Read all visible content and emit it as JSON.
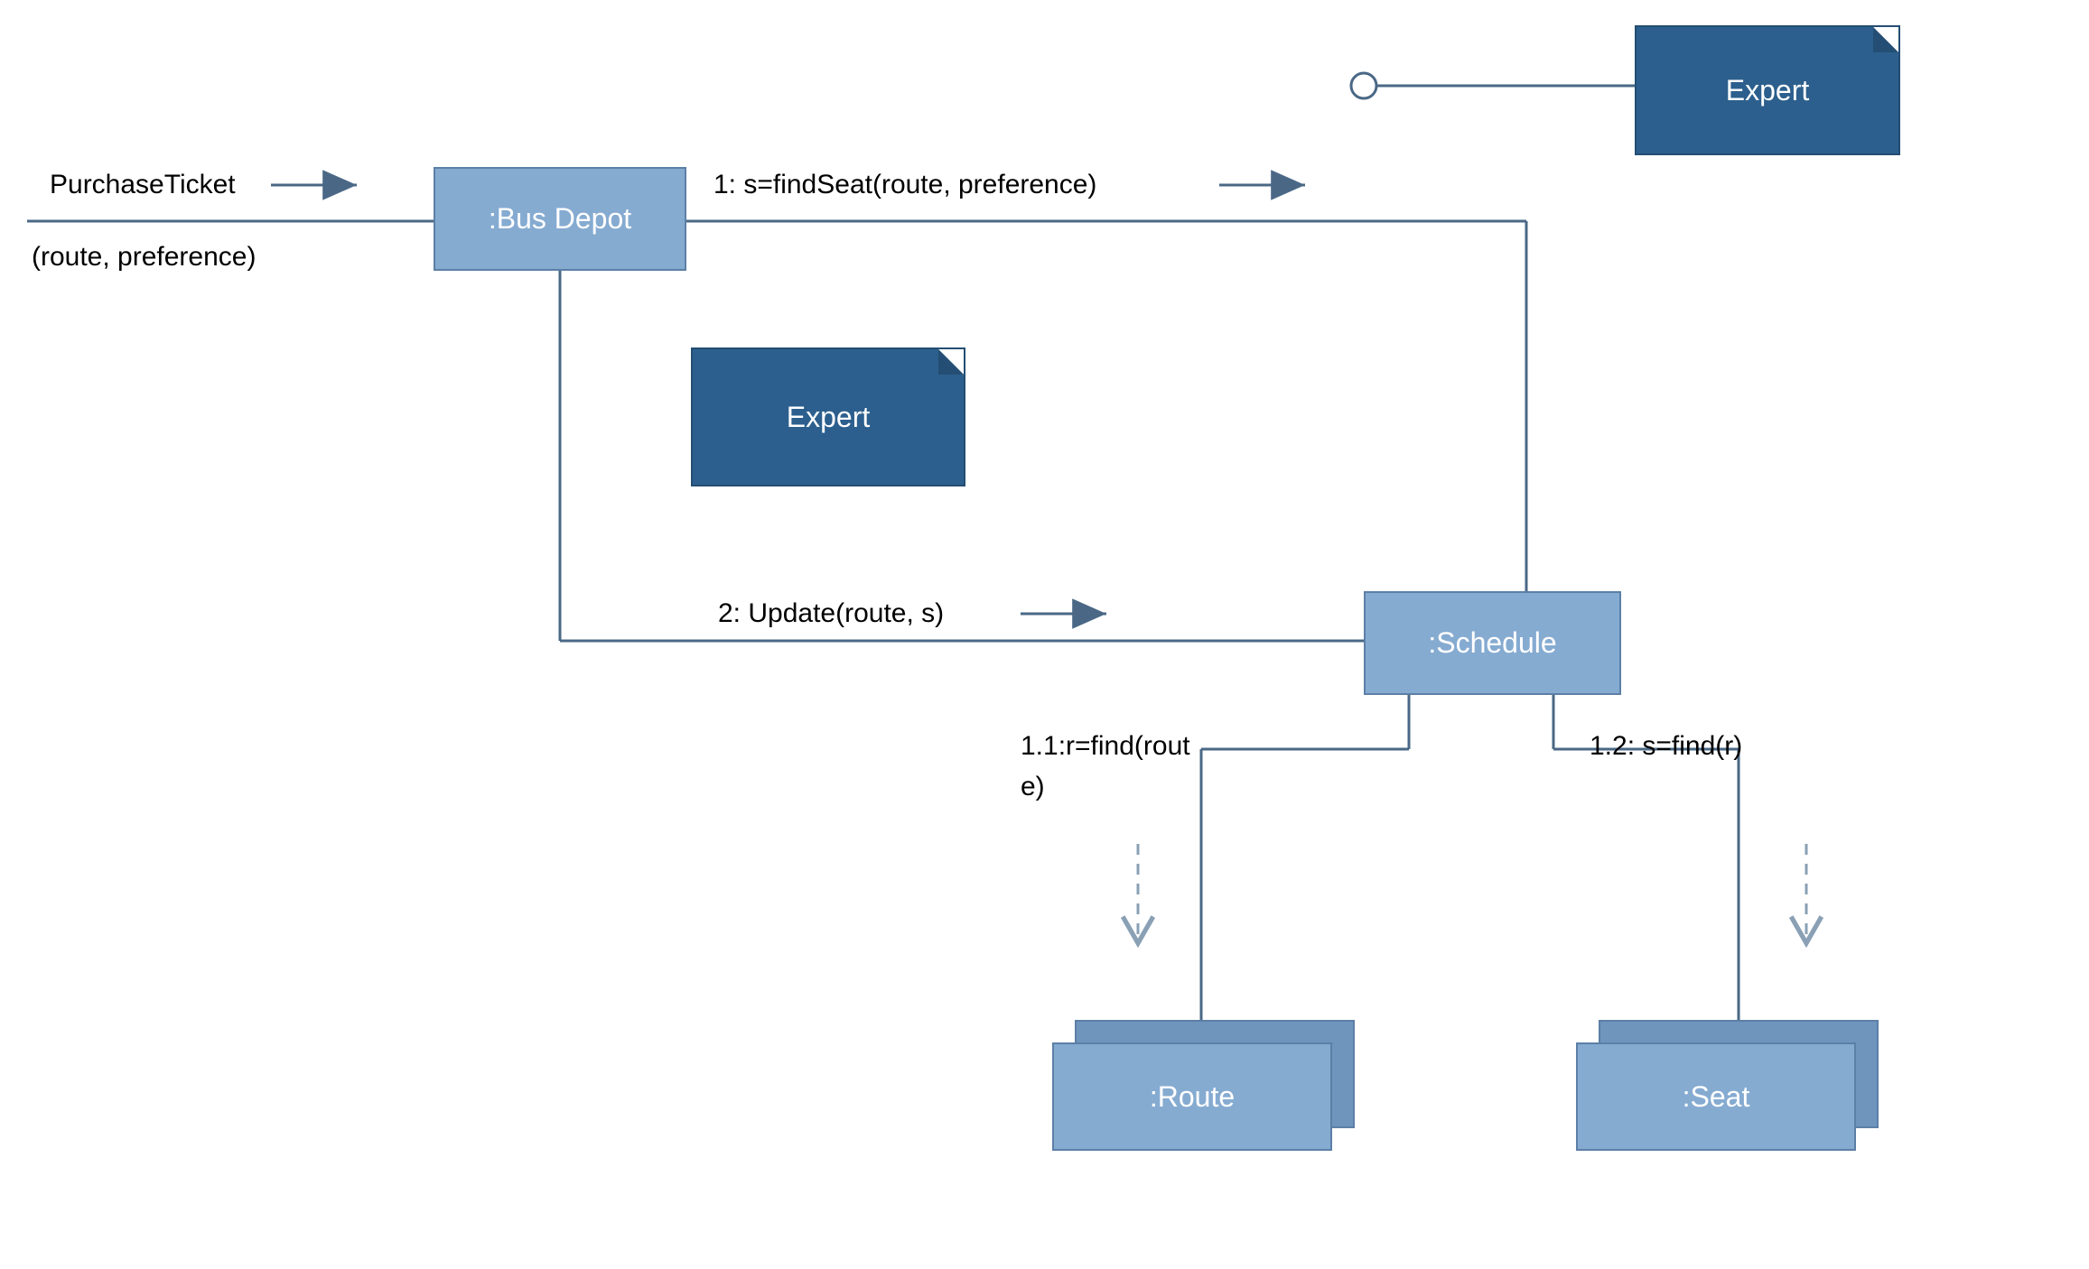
{
  "nodes": {
    "bus_depot": ":Bus Depot",
    "schedule": ":Schedule",
    "route": ":Route",
    "seat": ":Seat"
  },
  "notes": {
    "expert_top": "Expert",
    "expert_mid": "Expert"
  },
  "messages": {
    "purchase_ticket_top": "PurchaseTicket",
    "purchase_ticket_bottom": "(route, preference)",
    "msg1": "1: s=findSeat(route, preference)",
    "msg2": "2: Update(route, s)",
    "msg1_1_line1": "1.1:r=find(rout",
    "msg1_1_line2": "e)",
    "msg1_2": "1.2: s=find(r)"
  },
  "colors": {
    "node_fill": "#86abd1",
    "node_border": "#5c7fa6",
    "note_fill": "#2c5f8d",
    "note_border": "#244e73",
    "line": "#4a6886",
    "line_light": "#8aa0b5"
  }
}
